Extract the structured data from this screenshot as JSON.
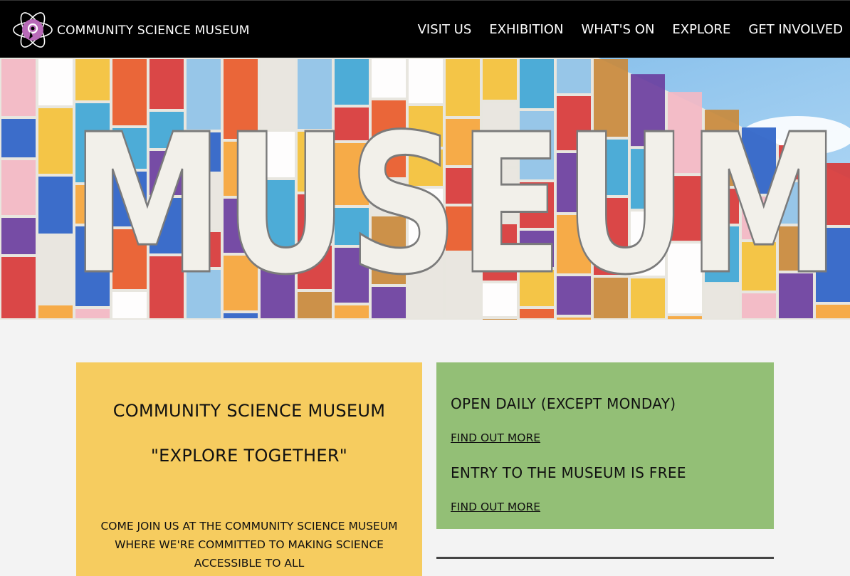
{
  "header": {
    "site_name": "COMMUNITY SCIENCE MUSEUM",
    "logo_icon": "atom-logo-icon",
    "nav": [
      {
        "label": "VISIT US"
      },
      {
        "label": "EXHIBITION"
      },
      {
        "label": "WHAT'S ON"
      },
      {
        "label": "EXPLORE"
      },
      {
        "label": "GET INVOLVED"
      }
    ]
  },
  "hero": {
    "sign_text": "MUSEUM"
  },
  "intro_card": {
    "title": "COMMUNITY SCIENCE MUSEUM",
    "slogan": "\"EXPLORE TOGETHER\"",
    "text": "COME JOIN US AT THE COMMUNITY SCIENCE MUSEUM WHERE WE'RE COMMITTED TO MAKING SCIENCE ACCESSIBLE TO ALL"
  },
  "info_card": {
    "hours_heading": "OPEN DAILY (EXCEPT MONDAY)",
    "hours_link": "FIND OUT MORE",
    "entry_heading": "ENTRY TO THE MUSEUM IS FREE",
    "entry_link": "FIND OUT MORE"
  },
  "colors": {
    "header_bg": "#000000",
    "intro_card_bg": "#f6cc5f",
    "info_card_bg": "#93bf76",
    "page_bg": "#f3f3f3",
    "logo_accent": "#b86ab8"
  }
}
